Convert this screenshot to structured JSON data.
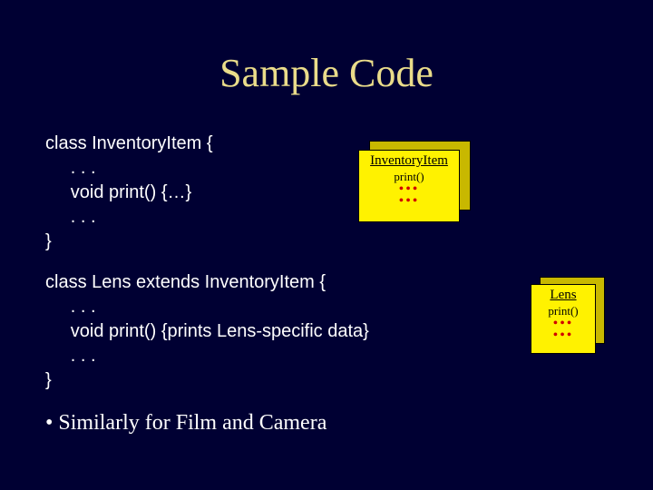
{
  "title": "Sample Code",
  "code_block1": {
    "l1": "class InventoryItem {",
    "l2": "     . . .",
    "l3": "     void print() {…}",
    "l4": "     . . .",
    "l5": "}"
  },
  "code_block2": {
    "l1": "class Lens extends InventoryItem {",
    "l2": "     . . .",
    "l3": "     void print() {prints Lens-specific data}",
    "l4": "     . . .",
    "l5": "}"
  },
  "bullet": "Similarly for Film and Camera",
  "box1": {
    "title": "InventoryItem",
    "line1": "print()",
    "dots": "•••"
  },
  "box2": {
    "title": "Lens",
    "line1": "print()",
    "dots": "•••"
  }
}
